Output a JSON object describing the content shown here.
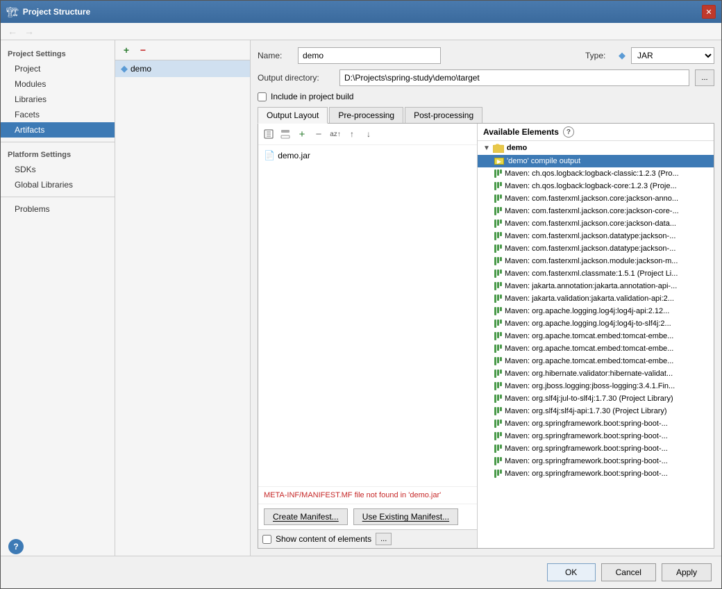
{
  "window": {
    "title": "Project Structure",
    "icon": "🏗"
  },
  "sidebar": {
    "project_settings_title": "Project Settings",
    "items": [
      {
        "label": "Project",
        "id": "project"
      },
      {
        "label": "Modules",
        "id": "modules"
      },
      {
        "label": "Libraries",
        "id": "libraries"
      },
      {
        "label": "Facets",
        "id": "facets"
      },
      {
        "label": "Artifacts",
        "id": "artifacts",
        "active": true
      }
    ],
    "platform_settings_title": "Platform Settings",
    "platform_items": [
      {
        "label": "SDKs",
        "id": "sdks"
      },
      {
        "label": "Global Libraries",
        "id": "global-libraries"
      }
    ],
    "other_items": [
      {
        "label": "Problems",
        "id": "problems"
      }
    ]
  },
  "artifact_list": {
    "add_btn": "+",
    "remove_btn": "−",
    "items": [
      {
        "name": "demo",
        "icon": "jar"
      }
    ]
  },
  "right": {
    "name_label": "Name:",
    "name_value": "demo",
    "type_label": "Type:",
    "type_icon": "◆",
    "type_value": "JAR",
    "output_dir_label": "Output directory:",
    "output_dir_value": "D:\\Projects\\spring-study\\demo\\target",
    "browse_btn": "...",
    "include_checkbox_label": "Include in project build",
    "tabs": [
      {
        "label": "Output Layout",
        "active": true
      },
      {
        "label": "Pre-processing"
      },
      {
        "label": "Post-processing"
      }
    ],
    "output_items": [
      {
        "name": "demo.jar",
        "icon": "jar"
      }
    ],
    "manifest_warning": "META-INF/MANIFEST.MF file not found in 'demo.jar'",
    "create_manifest_btn": "Create Manifest...",
    "use_existing_manifest_btn": "Use Existing Manifest...",
    "show_content_label": "Show content of elements",
    "settings_btn": "...",
    "available_elements_label": "Available Elements",
    "available_items": [
      {
        "label": "demo",
        "indent": 0,
        "type": "folder",
        "expanded": true
      },
      {
        "label": "'demo' compile output",
        "indent": 1,
        "type": "compile",
        "selected": true
      },
      {
        "label": "Maven: ch.qos.logback:logback-classic:1.2.3 (Pro...",
        "indent": 1,
        "type": "lib"
      },
      {
        "label": "Maven: ch.qos.logback:logback-core:1.2.3 (Proje...",
        "indent": 1,
        "type": "lib"
      },
      {
        "label": "Maven: com.fasterxml.jackson.core:jackson-anno...",
        "indent": 1,
        "type": "lib"
      },
      {
        "label": "Maven: com.fasterxml.jackson.core:jackson-core-...",
        "indent": 1,
        "type": "lib"
      },
      {
        "label": "Maven: com.fasterxml.jackson.core:jackson-data...",
        "indent": 1,
        "type": "lib"
      },
      {
        "label": "Maven: com.fasterxml.jackson.datatype:jackson-...",
        "indent": 1,
        "type": "lib"
      },
      {
        "label": "Maven: com.fasterxml.jackson.datatype:jackson-...",
        "indent": 1,
        "type": "lib"
      },
      {
        "label": "Maven: com.fasterxml.jackson.module:jackson-m...",
        "indent": 1,
        "type": "lib"
      },
      {
        "label": "Maven: com.fasterxml.classmate:1.5.1 (Project Li...",
        "indent": 1,
        "type": "lib"
      },
      {
        "label": "Maven: jakarta.annotation:jakarta.annotation-api-...",
        "indent": 1,
        "type": "lib"
      },
      {
        "label": "Maven: jakarta.validation:jakarta.validation-api:2...",
        "indent": 1,
        "type": "lib"
      },
      {
        "label": "Maven: org.apache.logging.log4j:log4j-api:2.12...",
        "indent": 1,
        "type": "lib"
      },
      {
        "label": "Maven: org.apache.logging.log4j:log4j-to-slf4j:2...",
        "indent": 1,
        "type": "lib"
      },
      {
        "label": "Maven: org.apache.tomcat.embed:tomcat-embe...",
        "indent": 1,
        "type": "lib"
      },
      {
        "label": "Maven: org.apache.tomcat.embed:tomcat-embe...",
        "indent": 1,
        "type": "lib"
      },
      {
        "label": "Maven: org.apache.tomcat.embed:tomcat-embe...",
        "indent": 1,
        "type": "lib"
      },
      {
        "label": "Maven: org.hibernate.validator:hibernate-validat...",
        "indent": 1,
        "type": "lib"
      },
      {
        "label": "Maven: org.jboss.logging:jboss-logging:3.4.1.Fin...",
        "indent": 1,
        "type": "lib"
      },
      {
        "label": "Maven: org.slf4j:jul-to-slf4j:1.7.30 (Project Library)",
        "indent": 1,
        "type": "lib"
      },
      {
        "label": "Maven: org.slf4j:slf4j-api:1.7.30 (Project Library)",
        "indent": 1,
        "type": "lib"
      },
      {
        "label": "Maven: org.springframework.boot:spring-boot-...",
        "indent": 1,
        "type": "lib"
      },
      {
        "label": "Maven: org.springframework.boot:spring-boot-...",
        "indent": 1,
        "type": "lib"
      },
      {
        "label": "Maven: org.springframework.boot:spring-boot-...",
        "indent": 1,
        "type": "lib"
      },
      {
        "label": "Maven: org.springframework.boot:spring-boot-...",
        "indent": 1,
        "type": "lib"
      },
      {
        "label": "Maven: org.springframework.boot:spring-boot-...",
        "indent": 1,
        "type": "lib"
      }
    ]
  },
  "bottom": {
    "ok_label": "OK",
    "cancel_label": "Cancel",
    "apply_label": "Apply"
  },
  "toolbar": {
    "back_arrow": "←",
    "forward_arrow": "→"
  }
}
